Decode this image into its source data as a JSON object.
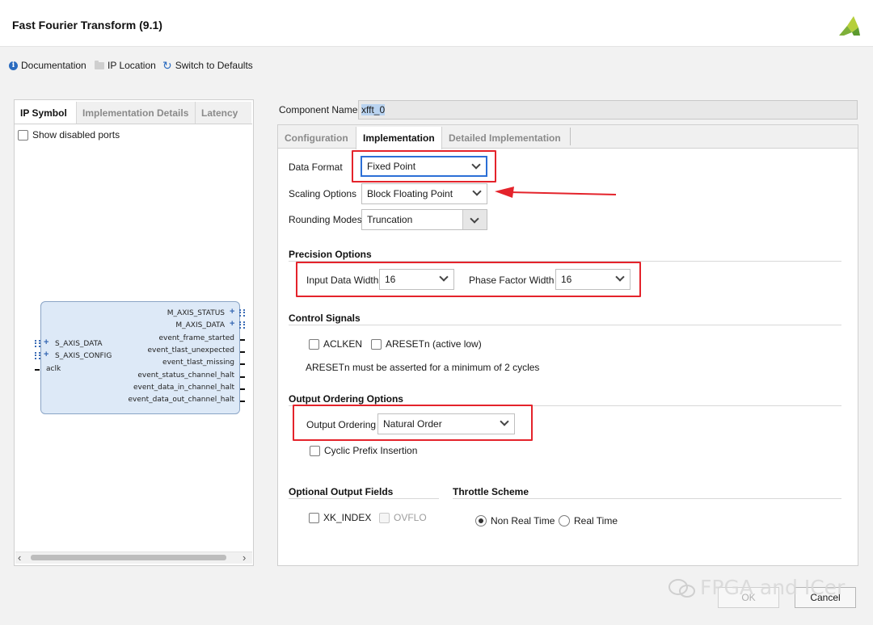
{
  "window": {
    "title": "Fast Fourier Transform (9.1)"
  },
  "toolbar": {
    "documentation": "Documentation",
    "ip_location": "IP Location",
    "switch_defaults": "Switch to Defaults"
  },
  "left_panel": {
    "tabs": [
      "IP Symbol",
      "Implementation Details",
      "Latency"
    ],
    "show_disabled_ports": "Show disabled ports",
    "ip_symbol": {
      "right_ports": [
        "M_AXIS_STATUS",
        "M_AXIS_DATA",
        "event_frame_started",
        "event_tlast_unexpected",
        "event_tlast_missing",
        "event_status_channel_halt",
        "event_data_in_channel_halt",
        "event_data_out_channel_halt"
      ],
      "left_ports": [
        "S_AXIS_DATA",
        "S_AXIS_CONFIG",
        "aclk"
      ]
    }
  },
  "component": {
    "label": "Component Name",
    "value": "xfft_0"
  },
  "right_tabs": [
    "Configuration",
    "Implementation",
    "Detailed Implementation"
  ],
  "implementation": {
    "data_format": {
      "label": "Data Format",
      "value": "Fixed Point"
    },
    "scaling_options": {
      "label": "Scaling Options",
      "value": "Block Floating Point"
    },
    "rounding_modes": {
      "label": "Rounding Modes",
      "value": "Truncation"
    },
    "precision": {
      "title": "Precision Options",
      "input_width_label": "Input Data Width",
      "input_width_value": "16",
      "phase_width_label": "Phase Factor Width",
      "phase_width_value": "16"
    },
    "control": {
      "title": "Control Signals",
      "aclken": "ACLKEN",
      "aresetn": "ARESETn (active low)",
      "note": "ARESETn must be asserted for a minimum of 2 cycles"
    },
    "output_ordering": {
      "title": "Output Ordering Options",
      "label": "Output Ordering",
      "value": "Natural Order",
      "cyclic_prefix": "Cyclic Prefix Insertion"
    },
    "optional_output": {
      "title": "Optional Output Fields",
      "xk_index": "XK_INDEX",
      "ovflo": "OVFLO"
    },
    "throttle": {
      "title": "Throttle Scheme",
      "non_real_time": "Non Real Time",
      "real_time": "Real Time"
    }
  },
  "buttons": {
    "ok": "OK",
    "cancel": "Cancel"
  },
  "watermark": "FPGA and ICer",
  "colors": {
    "annotation_red": "#e4232b",
    "focus_blue": "#2b6fd6",
    "ip_block_fill": "#dde9f7"
  }
}
